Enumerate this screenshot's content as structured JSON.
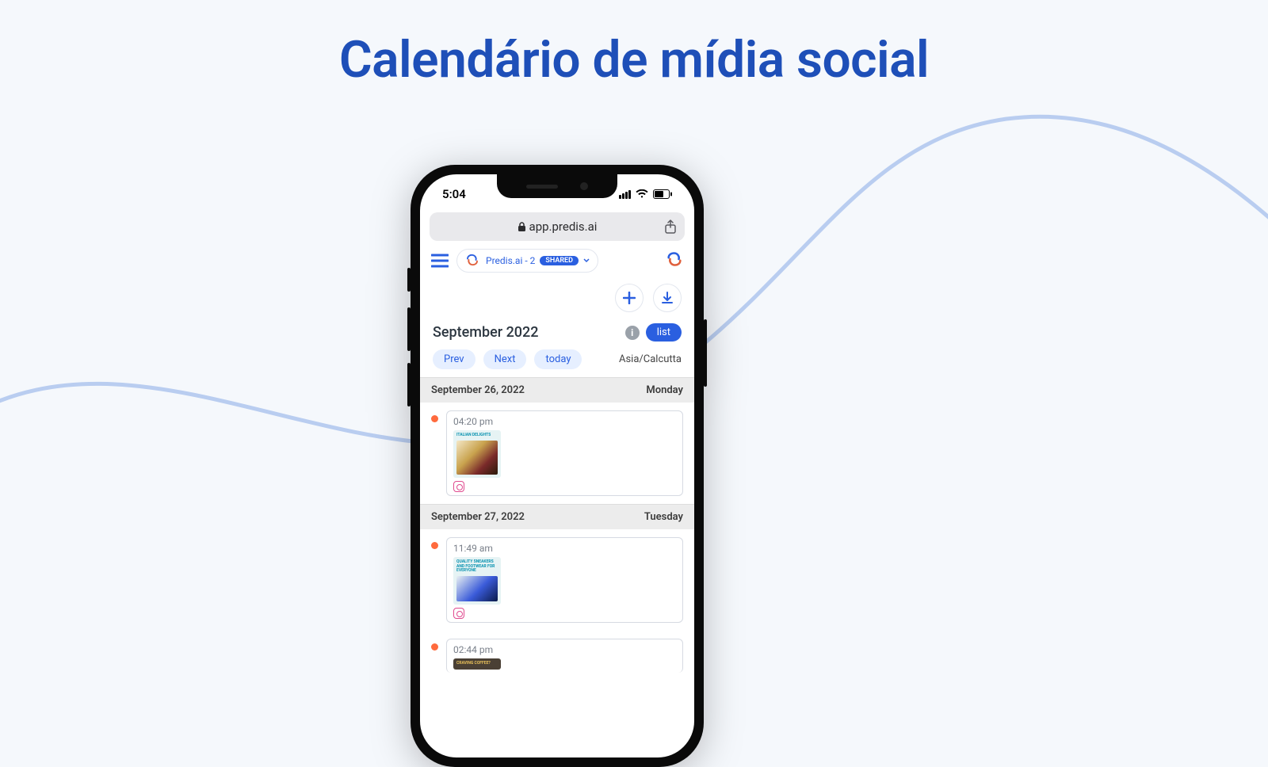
{
  "page_title": "Calendário de mídia social",
  "status": {
    "time": "5:04"
  },
  "browser": {
    "url": "app.predis.ai"
  },
  "header": {
    "workspace_name": "Predis.ai - 2",
    "shared_badge": "SHARED"
  },
  "month_bar": {
    "month": "September 2022",
    "view_label": "list"
  },
  "nav": {
    "prev": "Prev",
    "next": "Next",
    "today": "today",
    "timezone": "Asia/Calcutta"
  },
  "days": [
    {
      "date": "September 26, 2022",
      "weekday": "Monday",
      "posts": [
        {
          "time": "04:20 pm",
          "thumb_caption": "ITALIAN DELIGHTS",
          "thumb_gradient": "linear-gradient(135deg,#f4e7c6 0%,#c9a34e 40%,#7a2a2a 70%,#2a1a0a 100%)"
        }
      ]
    },
    {
      "date": "September 27, 2022",
      "weekday": "Tuesday",
      "posts": [
        {
          "time": "11:49 am",
          "thumb_caption": "QUALITY SNEAKERS AND FOOTWEAR FOR EVERYONE",
          "thumb_gradient": "linear-gradient(135deg,#e8f0f2 0%,#3a5bd9 55%,#0a1a4a 100%)"
        },
        {
          "time": "02:44 pm",
          "thumb_caption": "CRAVING COFFEE?",
          "thumb_gradient": "linear-gradient(135deg,#d9a84a 0%,#7a4a1a 60%,#2a1a0a 100%)",
          "thumb_bg": "#4a4035"
        }
      ]
    }
  ]
}
